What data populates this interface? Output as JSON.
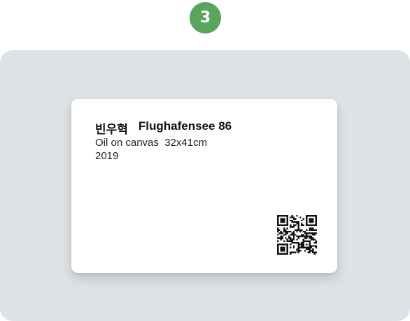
{
  "step": {
    "number": "3",
    "color": "#5aa55d"
  },
  "label": {
    "artist": "빈우혁",
    "title": "Flughafensee 86",
    "medium": "Oil on canvas  32x41cm",
    "year": "2019"
  },
  "colors": {
    "panel_background": "#dde2e5",
    "card_background": "#ffffff",
    "text": "#111111"
  },
  "qr_code": {
    "icon": "qr-code-icon"
  }
}
